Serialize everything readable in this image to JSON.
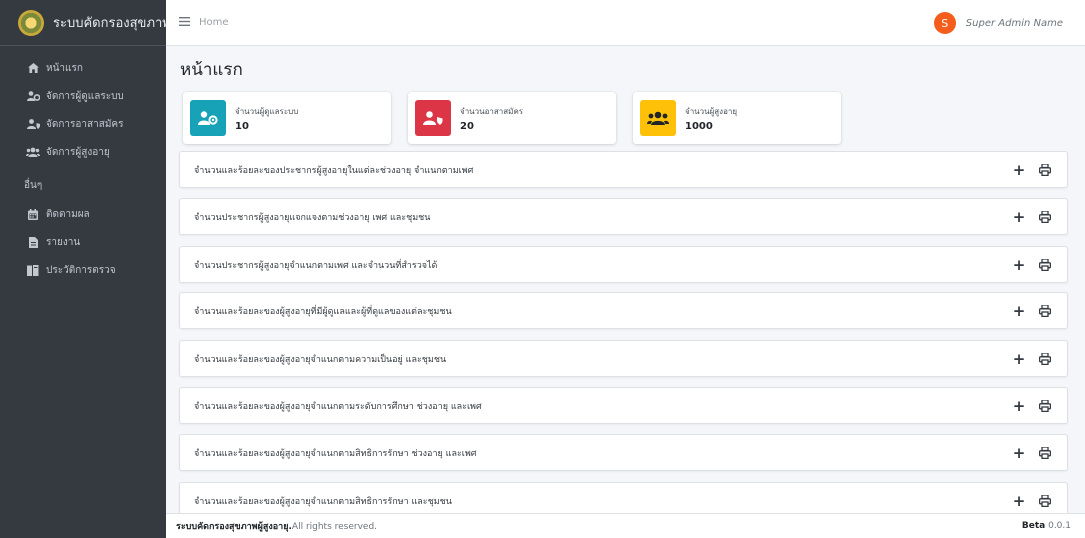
{
  "brand": {
    "title": "ระบบคัดกรองสุขภาพ"
  },
  "sidebar": {
    "items": [
      {
        "label": "หน้าแรก",
        "icon": "home-icon"
      },
      {
        "label": "จัดการผู้ดูแลระบบ",
        "icon": "users-cog-icon"
      },
      {
        "label": "จัดการอาสาสมัคร",
        "icon": "user-shield-icon"
      },
      {
        "label": "จัดการผู้สูงอายุ",
        "icon": "users-icon"
      }
    ],
    "header": "อื่นๆ",
    "items2": [
      {
        "label": "ติดตามผล",
        "icon": "calendar-icon"
      },
      {
        "label": "รายงาน",
        "icon": "file-icon"
      },
      {
        "label": "ประวัติการตรวจ",
        "icon": "history-book-icon"
      }
    ]
  },
  "topbar": {
    "breadcrumb": "Home",
    "user_initial": "S",
    "user_name": "Super Admin Name"
  },
  "page": {
    "title": "หน้าแรก"
  },
  "stats": [
    {
      "label": "จำนวนผู้ดูแลระบบ",
      "value": "10",
      "color": "#17a2b8",
      "icon": "users-cog-icon"
    },
    {
      "label": "จำนวนอาสาสมัคร",
      "value": "20",
      "color": "#dc3545",
      "icon": "user-shield-icon"
    },
    {
      "label": "จำนวนผู้สูงอายุ",
      "value": "1000",
      "color": "#ffc107",
      "icon": "users-icon"
    }
  ],
  "reports": [
    "จำนวนและร้อยละของประชากรผู้สูงอายุในแต่ละช่วงอายุ จำแนกตามเพศ",
    "จำนวนประชากรผู้สูงอายุแจกแจงตามช่วงอายุ เพศ และชุมชน",
    "จำนวนประชากรผู้สูงอายุจำแนกตามเพศ และจำนวนที่สำรวจได้",
    "จำนวนและร้อยละของผู้สูงอายุที่มีผู้ดูแลและผู้ที่ดูแลของแต่ละชุมชน",
    "จำนวนและร้อยละของผู้สูงอายุจำแนกตามความเป็นอยู่ และชุมชน",
    "จำนวนและร้อยละของผู้สูงอายุจำแนกตามระดับการศึกษา ช่วงอายุ และเพศ",
    "จำนวนและร้อยละของผู้สูงอายุจำแนกตามสิทธิการรักษา ช่วงอายุ และเพศ",
    "จำนวนและร้อยละของผู้สูงอายุจำแนกตามสิทธิการรักษา และชุมชน"
  ],
  "card_tools": {
    "plus": "+"
  },
  "footer": {
    "strong": "ระบบคัดกรองสุขภาพผู้สูงอายุ.",
    "rest": "All rights reserved.",
    "version_label": "Beta",
    "version": "0.0.1"
  },
  "colors": {
    "sidebar_bg": "#343a40",
    "avatar": "#f45d1c"
  }
}
